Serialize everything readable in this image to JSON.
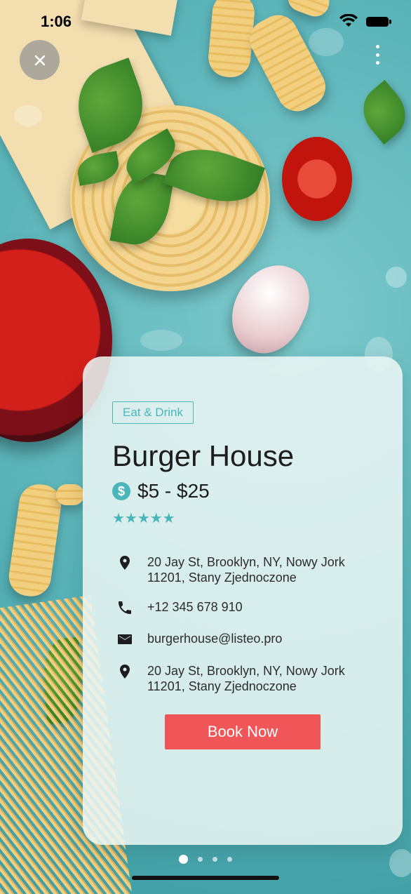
{
  "status_bar": {
    "time": "1:06"
  },
  "listing": {
    "category": "Eat & Drink",
    "title": "Burger House",
    "price_symbol": "$",
    "price": "$5 - $25",
    "rating_stars": 5,
    "stars": "★★★★★",
    "details": [
      {
        "icon": "location-pin-icon",
        "text": "20 Jay St, Brooklyn, NY, Nowy Jork 11201, Stany Zjednoczone"
      },
      {
        "icon": "phone-icon",
        "text": "+12 345 678 910"
      },
      {
        "icon": "mail-icon",
        "text": "burgerhouse@listeo.pro"
      },
      {
        "icon": "location-pin-icon",
        "text": "20 Jay St, Brooklyn, NY, Nowy Jork 11201, Stany Zjednoczone"
      }
    ],
    "book_label": "Book Now"
  },
  "pager": {
    "count": 4,
    "active": 0
  },
  "colors": {
    "accent": "#4bb6b9",
    "book_button": "#f05658"
  }
}
